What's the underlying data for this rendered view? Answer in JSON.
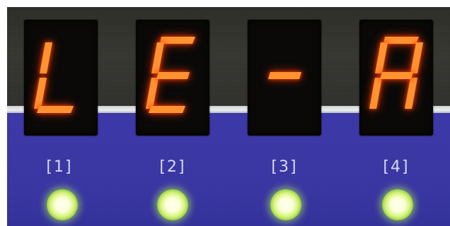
{
  "display": {
    "digits": [
      {
        "char": "L",
        "segments": [
          "b_left_top",
          "b_left_bottom",
          "d"
        ]
      },
      {
        "char": "E",
        "segments": [
          "a",
          "b_left_top",
          "b_left_bottom",
          "g",
          "d"
        ]
      },
      {
        "char": "-",
        "segments": [
          "g"
        ]
      },
      {
        "char": "A",
        "segments": [
          "a",
          "b_left_top",
          "b_left_bottom",
          "b_right_top",
          "b_right_bottom",
          "g"
        ]
      }
    ],
    "color": "#ff5a12"
  },
  "channels": [
    {
      "label": "[1]"
    },
    {
      "label": "[2]"
    },
    {
      "label": "[3]"
    },
    {
      "label": "[4]"
    }
  ],
  "indicator_color": "#c8f26a"
}
